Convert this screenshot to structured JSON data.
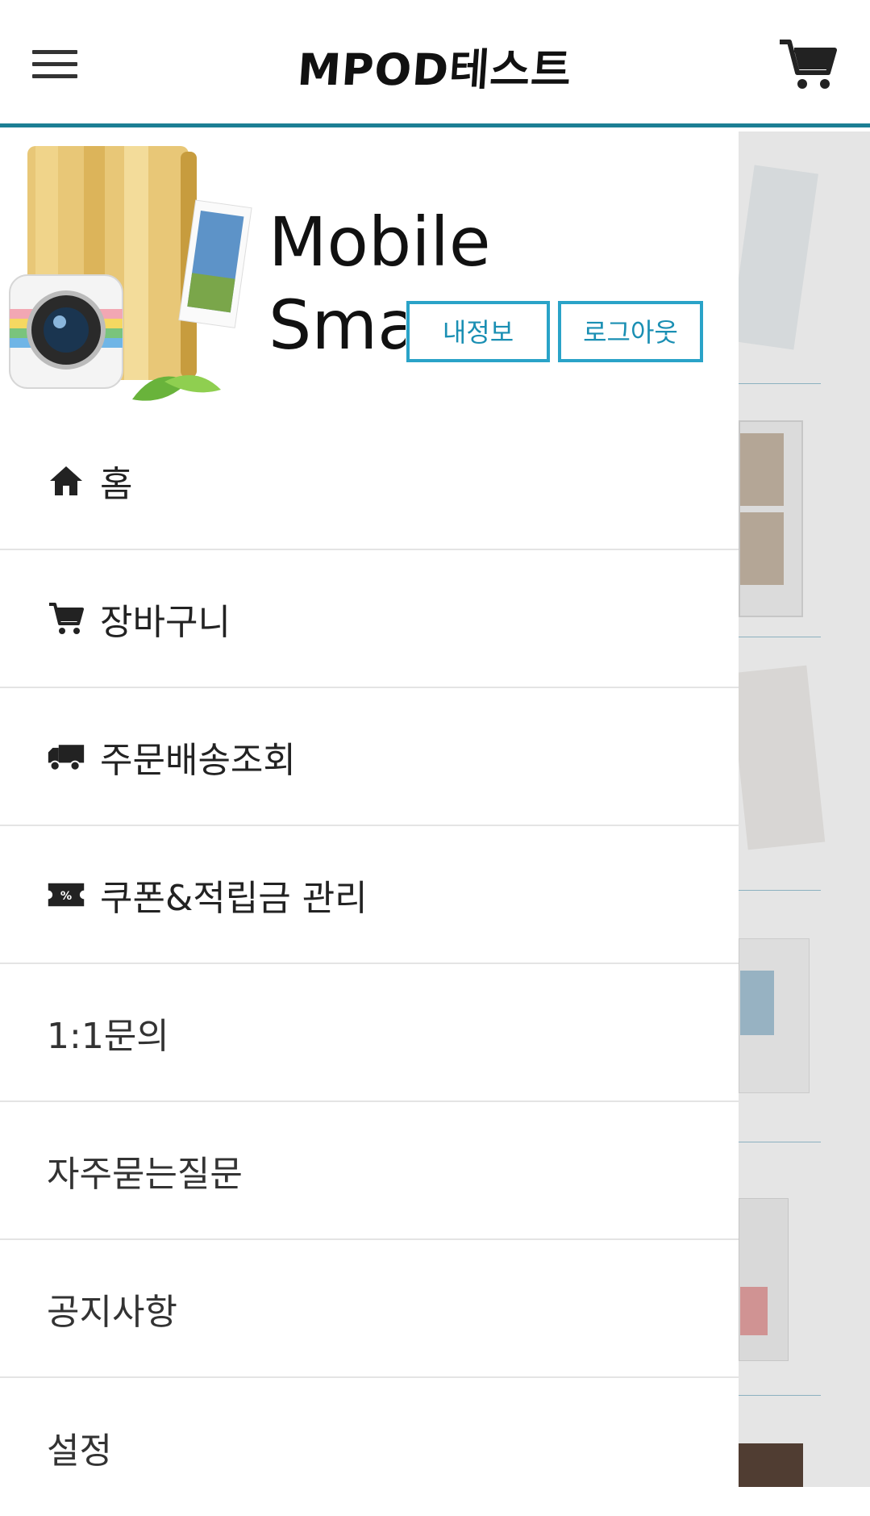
{
  "header": {
    "title": "MPOD테스트",
    "menu_icon": "hamburger-menu-icon",
    "cart_icon": "shopping-cart-icon"
  },
  "drawer": {
    "brand_line1": "Mobile",
    "brand_line2": "Smart Photo",
    "buttons": {
      "my_info": "내정보",
      "logout": "로그아웃"
    },
    "menu": [
      {
        "label": "홈",
        "icon": "home-icon"
      },
      {
        "label": "장바구니",
        "icon": "cart-icon"
      },
      {
        "label": "주문배송조회",
        "icon": "truck-icon"
      },
      {
        "label": "쿠폰&적립금 관리",
        "icon": "coupon-icon"
      },
      {
        "label": "1:1문의",
        "icon": ""
      },
      {
        "label": "자주묻는질문",
        "icon": ""
      },
      {
        "label": "공지사항",
        "icon": ""
      },
      {
        "label": "설정",
        "icon": ""
      }
    ]
  },
  "colors": {
    "accent": "#1c7f94",
    "button_border": "#2aa3c8"
  }
}
